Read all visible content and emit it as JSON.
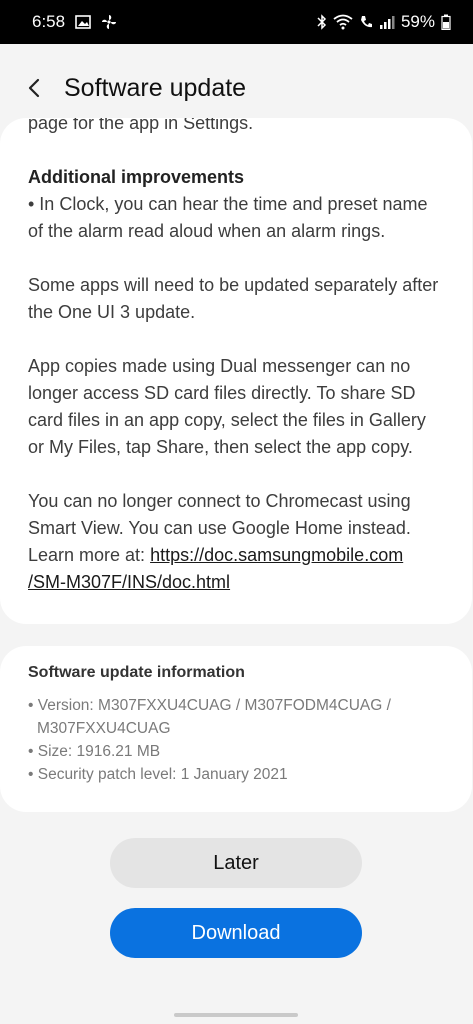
{
  "status": {
    "time": "6:58",
    "battery": "59%",
    "icons_left": [
      "image-icon",
      "fan-icon"
    ],
    "icons_right": [
      "bluetooth-icon",
      "wifi-icon",
      "call-icon",
      "signal-icon",
      "battery-icon"
    ]
  },
  "header": {
    "title": "Software update",
    "back_icon": "back-arrow-icon"
  },
  "notes": {
    "line_partial": "page for the app in Settings.",
    "additional_heading": "Additional improvements",
    "clock_note": "• In Clock, you can hear the time and preset name of the alarm read aloud when an alarm rings.",
    "apps_note": "Some apps will need to be updated separately after the One UI 3 update.",
    "dual_messenger_note": "App copies made using Dual messenger can no longer access SD card files directly. To share SD card files in an app copy, select the files in Gallery or My Files, tap Share, then select the app copy.",
    "chromecast_note": "You can no longer connect to Chromecast using Smart View. You can use Google Home instead. Learn more at:",
    "link_line1": "https://doc.samsungmobile.com",
    "link_line2": "/SM-M307F/INS/doc.html"
  },
  "info": {
    "title": "Software update information",
    "version_line1": "• Version: M307FXXU4CUAG / M307FODM4CUAG /",
    "version_line2": "M307FXXU4CUAG",
    "size": "• Size: 1916.21 MB",
    "security": "• Security patch level: 1 January 2021"
  },
  "buttons": {
    "later": "Later",
    "download": "Download"
  },
  "colors": {
    "accent": "#0a72e0",
    "background": "#f4f4f4"
  }
}
